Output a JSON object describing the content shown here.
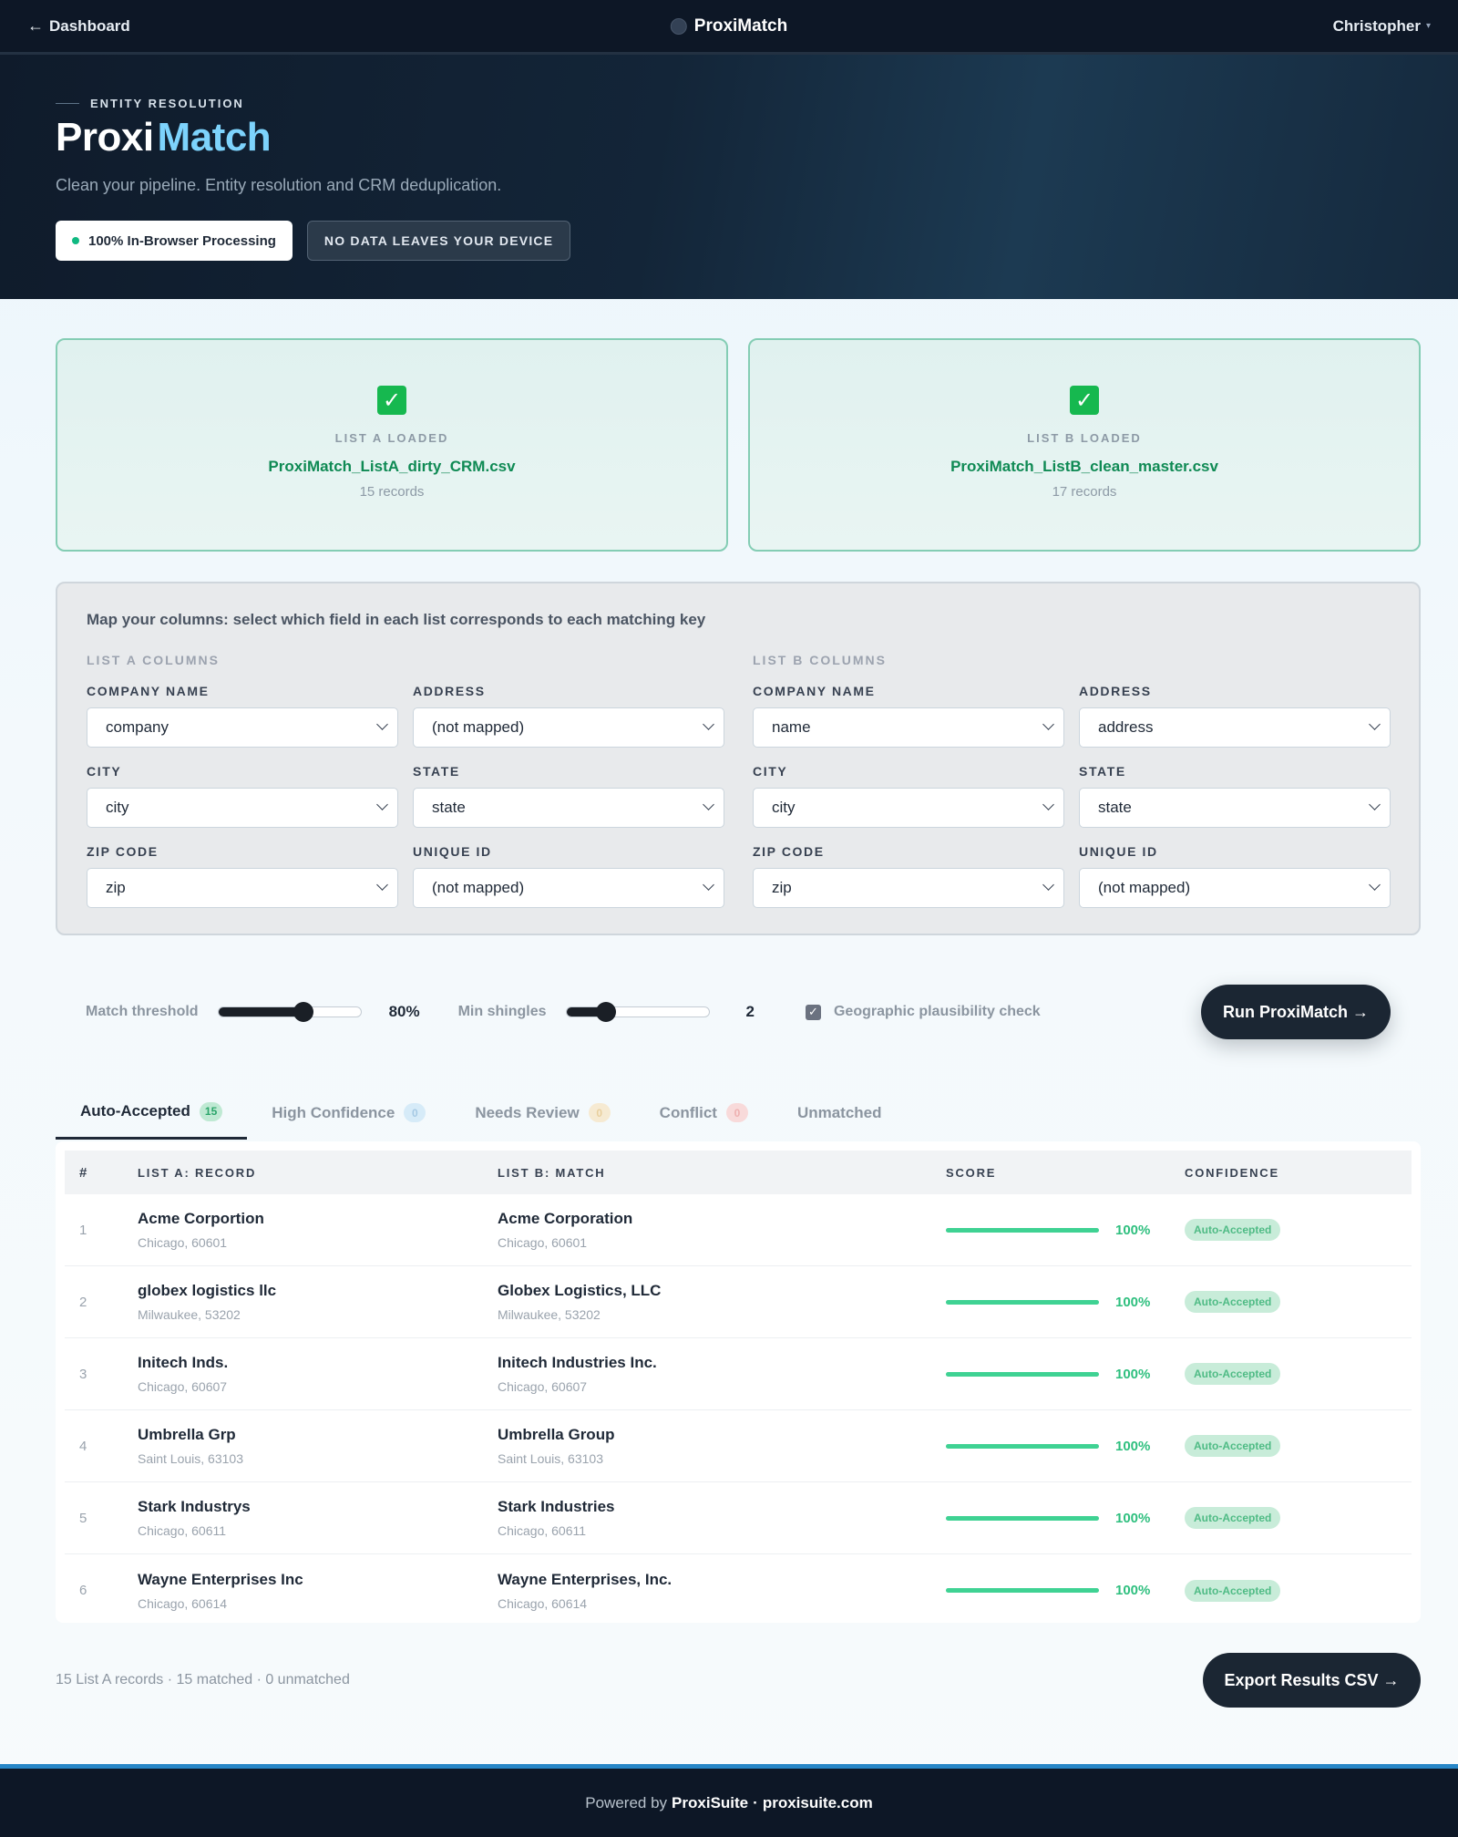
{
  "nav": {
    "back_label": "Dashboard",
    "brand": "ProxiMatch",
    "user": "Christopher"
  },
  "hero": {
    "eyebrow": "ENTITY RESOLUTION",
    "title_part1": "Proxi",
    "title_part2": "Match",
    "subtitle": "Clean your pipeline. Entity resolution and CRM deduplication.",
    "badge_processing": "100% In-Browser Processing",
    "badge_privacy": "NO DATA LEAVES YOUR DEVICE"
  },
  "uploads": [
    {
      "label": "LIST A LOADED",
      "file": "ProxiMatch_ListA_dirty_CRM.csv",
      "count": "15 records"
    },
    {
      "label": "LIST B LOADED",
      "file": "ProxiMatch_ListB_clean_master.csv",
      "count": "17 records"
    }
  ],
  "mapping": {
    "title": "Map your columns: select which field in each list corresponds to each matching key",
    "list_a": {
      "header": "LIST A COLUMNS",
      "fields": [
        {
          "label": "COMPANY NAME",
          "value": "company"
        },
        {
          "label": "ADDRESS",
          "value": "(not mapped)"
        },
        {
          "label": "CITY",
          "value": "city"
        },
        {
          "label": "STATE",
          "value": "state"
        },
        {
          "label": "ZIP CODE",
          "value": "zip"
        },
        {
          "label": "UNIQUE ID",
          "value": "(not mapped)"
        }
      ]
    },
    "list_b": {
      "header": "LIST B COLUMNS",
      "fields": [
        {
          "label": "COMPANY NAME",
          "value": "name"
        },
        {
          "label": "ADDRESS",
          "value": "address"
        },
        {
          "label": "CITY",
          "value": "city"
        },
        {
          "label": "STATE",
          "value": "state"
        },
        {
          "label": "ZIP CODE",
          "value": "zip"
        },
        {
          "label": "UNIQUE ID",
          "value": "(not mapped)"
        }
      ]
    }
  },
  "controls": {
    "threshold_label": "Match threshold",
    "threshold_value": "80%",
    "threshold_fraction": 0.6,
    "shingles_label": "Min shingles",
    "shingles_value": "2",
    "shingles_fraction": 0.28,
    "geo_check_label": "Geographic plausibility check",
    "geo_check_checked": true,
    "run_label": "Run ProxiMatch →"
  },
  "tabs": [
    {
      "label": "Auto-Accepted",
      "count": "15",
      "tone": "green",
      "active": true
    },
    {
      "label": "High Confidence",
      "count": "0",
      "tone": "blue",
      "active": false
    },
    {
      "label": "Needs Review",
      "count": "0",
      "tone": "amber",
      "active": false
    },
    {
      "label": "Conflict",
      "count": "0",
      "tone": "red",
      "active": false
    },
    {
      "label": "Unmatched",
      "count": null,
      "tone": "",
      "active": false
    }
  ],
  "table": {
    "headers": [
      "#",
      "LIST A: RECORD",
      "LIST B: MATCH",
      "SCORE",
      "CONFIDENCE"
    ],
    "rows": [
      {
        "num": "1",
        "a_name": "Acme Corportion",
        "a_loc": "Chicago, 60601",
        "b_name": "Acme Corporation",
        "b_loc": "Chicago, 60601",
        "score": "100%",
        "score_fraction": 1.0,
        "confidence": "Auto-Accepted"
      },
      {
        "num": "2",
        "a_name": "globex logistics llc",
        "a_loc": "Milwaukee, 53202",
        "b_name": "Globex Logistics, LLC",
        "b_loc": "Milwaukee, 53202",
        "score": "100%",
        "score_fraction": 1.0,
        "confidence": "Auto-Accepted"
      },
      {
        "num": "3",
        "a_name": "Initech Inds.",
        "a_loc": "Chicago, 60607",
        "b_name": "Initech Industries Inc.",
        "b_loc": "Chicago, 60607",
        "score": "100%",
        "score_fraction": 1.0,
        "confidence": "Auto-Accepted"
      },
      {
        "num": "4",
        "a_name": "Umbrella Grp",
        "a_loc": "Saint Louis, 63103",
        "b_name": "Umbrella Group",
        "b_loc": "Saint Louis, 63103",
        "score": "100%",
        "score_fraction": 1.0,
        "confidence": "Auto-Accepted"
      },
      {
        "num": "5",
        "a_name": "Stark Industrys",
        "a_loc": "Chicago, 60611",
        "b_name": "Stark Industries",
        "b_loc": "Chicago, 60611",
        "score": "100%",
        "score_fraction": 1.0,
        "confidence": "Auto-Accepted"
      },
      {
        "num": "6",
        "a_name": "Wayne Enterprises Inc",
        "a_loc": "Chicago, 60614",
        "b_name": "Wayne Enterprises, Inc.",
        "b_loc": "Chicago, 60614",
        "score": "100%",
        "score_fraction": 1.0,
        "confidence": "Auto-Accepted"
      }
    ]
  },
  "summary": "15 List A records · 15 matched · 0 unmatched",
  "export_label": "Export Results CSV →",
  "footer": {
    "prefix": "Powered by",
    "brand": "ProxiSuite",
    "sep": "·",
    "url": "proxisuite.com"
  },
  "colors": {
    "accent": "#7dd3fc",
    "success": "#10b981",
    "score_bar": "#3fd293",
    "dark": "#1b2633"
  }
}
